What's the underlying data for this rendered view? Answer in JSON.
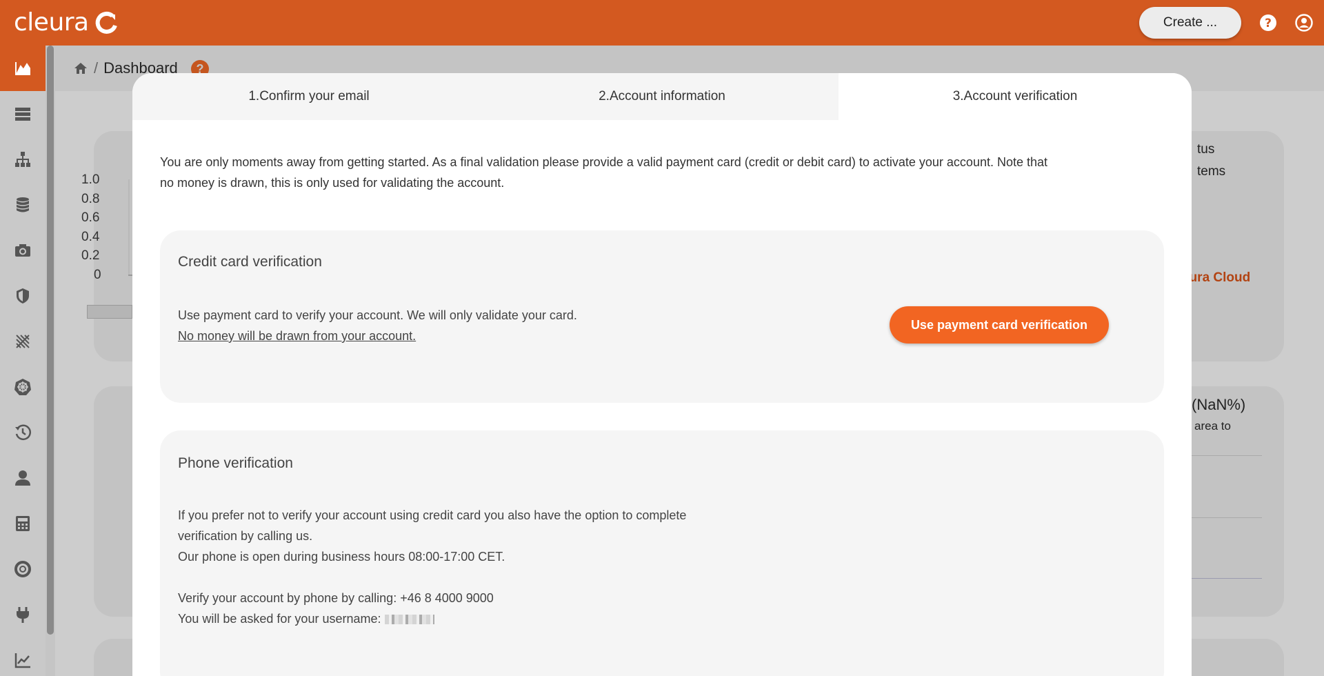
{
  "app": {
    "logo_text": "cleura",
    "create_label": "Create ..."
  },
  "breadcrumb": {
    "home_icon": "home-icon",
    "separator": "/",
    "current": "Dashboard",
    "help_glyph": "?"
  },
  "sidebar": {
    "items": [
      {
        "icon": "dashboard-chart-icon",
        "active": true
      },
      {
        "icon": "servers-icon"
      },
      {
        "icon": "network-icon"
      },
      {
        "icon": "database-icon"
      },
      {
        "icon": "camera-icon"
      },
      {
        "icon": "shield-icon"
      },
      {
        "icon": "kubernetes-lines-icon"
      },
      {
        "icon": "helm-wheel-icon"
      },
      {
        "icon": "history-icon"
      },
      {
        "icon": "user-icon"
      },
      {
        "icon": "calculator-icon"
      },
      {
        "icon": "support-icon"
      },
      {
        "icon": "plug-icon"
      },
      {
        "icon": "trend-chart-icon"
      }
    ]
  },
  "background": {
    "axis_ticks": [
      "1.0",
      "0.8",
      "0.6",
      "0.4",
      "0.2",
      "0"
    ],
    "status_title": "tus",
    "status_sub": "tems",
    "cloud_link": "eura Cloud",
    "nan_title": "(NaN%)",
    "nan_sub": "area to"
  },
  "modal": {
    "tabs": [
      {
        "label": "1.Confirm your email",
        "active": false
      },
      {
        "label": "2.Account information",
        "active": false
      },
      {
        "label": "3.Account verification",
        "active": true
      }
    ],
    "intro_line1": "You are only moments away from getting started. As a final validation please provide a valid payment card (credit or debit card) to activate your account. Note that",
    "intro_line2": "no money is drawn, this is only used for validating the account.",
    "credit": {
      "title": "Credit card verification",
      "text_line1": "Use payment card to verify your account. We will only validate your card.",
      "text_line2": "No money will be drawn from your account.",
      "button_label": "Use payment card verification"
    },
    "phone": {
      "title": "Phone verification",
      "line1": "If you prefer not to verify your account using credit card you also have the option to complete",
      "line2": "verification by calling us.",
      "line3": "Our phone is open during business hours 08:00-17:00 CET.",
      "line4": "Verify your account by phone by calling: +46 8 4000 9000",
      "line5": "You will be asked for your username:"
    }
  }
}
